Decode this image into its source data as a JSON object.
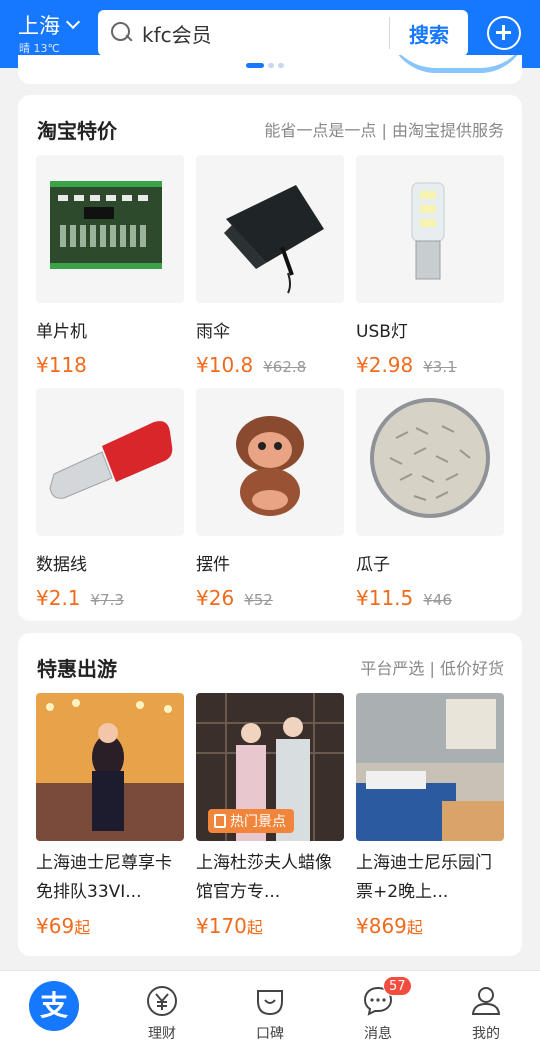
{
  "header": {
    "city": "上海",
    "weather": "晴 13℃",
    "search_query": "kfc会员",
    "search_button": "搜索"
  },
  "deals": {
    "title": "淘宝特价",
    "subtitle": "能省一点是一点 | 由淘宝提供服务",
    "items": [
      {
        "name": "单片机",
        "price": "¥118",
        "original": ""
      },
      {
        "name": "雨伞",
        "price": "¥10.8",
        "original": "¥62.8"
      },
      {
        "name": "USB灯",
        "price": "¥2.98",
        "original": "¥3.1"
      },
      {
        "name": "数据线",
        "price": "¥2.1",
        "original": "¥7.3"
      },
      {
        "name": "摆件",
        "price": "¥26",
        "original": "¥52"
      },
      {
        "name": "瓜子",
        "price": "¥11.5",
        "original": "¥46"
      }
    ]
  },
  "travel": {
    "title": "特惠出游",
    "subtitle": "平台严选 | 低价好货",
    "items": [
      {
        "name": "上海迪士尼尊享卡免排队33VI...",
        "price": "¥69",
        "suffix": "起",
        "badge": ""
      },
      {
        "name": "上海杜莎夫人蜡像馆官方专...",
        "price": "¥170",
        "suffix": "起",
        "badge": "热门景点"
      },
      {
        "name": "上海迪士尼乐园门票+2晚上...",
        "price": "¥869",
        "suffix": "起",
        "badge": ""
      }
    ]
  },
  "nav": {
    "home_glyph": "支",
    "items": [
      {
        "label": "理财"
      },
      {
        "label": "口碑"
      },
      {
        "label": "消息"
      },
      {
        "label": "我的"
      }
    ],
    "unread_count": "57"
  },
  "colors": {
    "brand": "#1677ff",
    "price": "#f06b1e",
    "badge": "#f24d3e"
  }
}
